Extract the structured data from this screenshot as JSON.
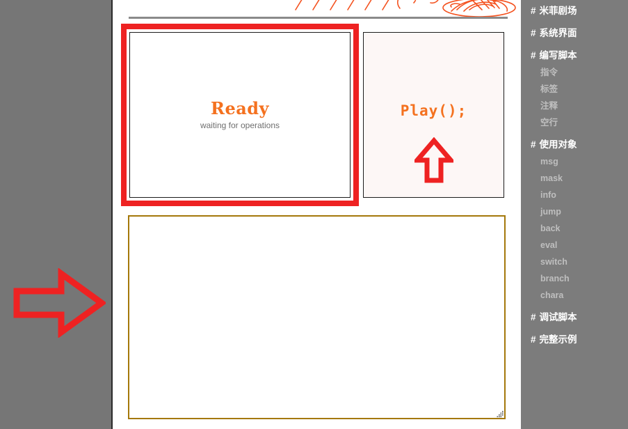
{
  "app": {
    "background_color": "#767676",
    "page_background": "#ffffff"
  },
  "main": {
    "status_panel": {
      "title": "Ready",
      "subtitle": "waiting for operations",
      "title_color": "#f4711f",
      "subtitle_color": "#6e6e6e",
      "highlight_color": "#ee2222"
    },
    "play_panel": {
      "code": "Play();",
      "code_color": "#f4711f",
      "background": "#fdf7f6",
      "annotation": "up-arrow"
    },
    "script_editor": {
      "value": "",
      "placeholder": "",
      "border_color": "#a4780a"
    },
    "annotations": {
      "left_arrow": "right-pointing-arrow",
      "arrow_color": "#ee2222",
      "scribble_color": "#f4521f"
    }
  },
  "sidebar": {
    "background": "#7c7c7c",
    "sections": [
      {
        "type": "head",
        "hash": "#",
        "label": "米菲剧场"
      },
      {
        "type": "head",
        "hash": "#",
        "label": "系统界面"
      },
      {
        "type": "head",
        "hash": "#",
        "label": "编写脚本"
      },
      {
        "type": "sub",
        "label": "指令"
      },
      {
        "type": "sub",
        "label": "标签"
      },
      {
        "type": "sub",
        "label": "注释"
      },
      {
        "type": "sub",
        "label": "空行"
      },
      {
        "type": "head",
        "hash": "#",
        "label": "使用对象"
      },
      {
        "type": "sub",
        "label": "msg"
      },
      {
        "type": "sub",
        "label": "mask"
      },
      {
        "type": "sub",
        "label": "info"
      },
      {
        "type": "sub",
        "label": "jump"
      },
      {
        "type": "sub",
        "label": "back"
      },
      {
        "type": "sub",
        "label": "eval"
      },
      {
        "type": "sub",
        "label": "switch"
      },
      {
        "type": "sub",
        "label": "branch"
      },
      {
        "type": "sub",
        "label": "chara"
      },
      {
        "type": "head",
        "hash": "#",
        "label": "调试脚本"
      },
      {
        "type": "head",
        "hash": "#",
        "label": "完整示例"
      }
    ]
  }
}
